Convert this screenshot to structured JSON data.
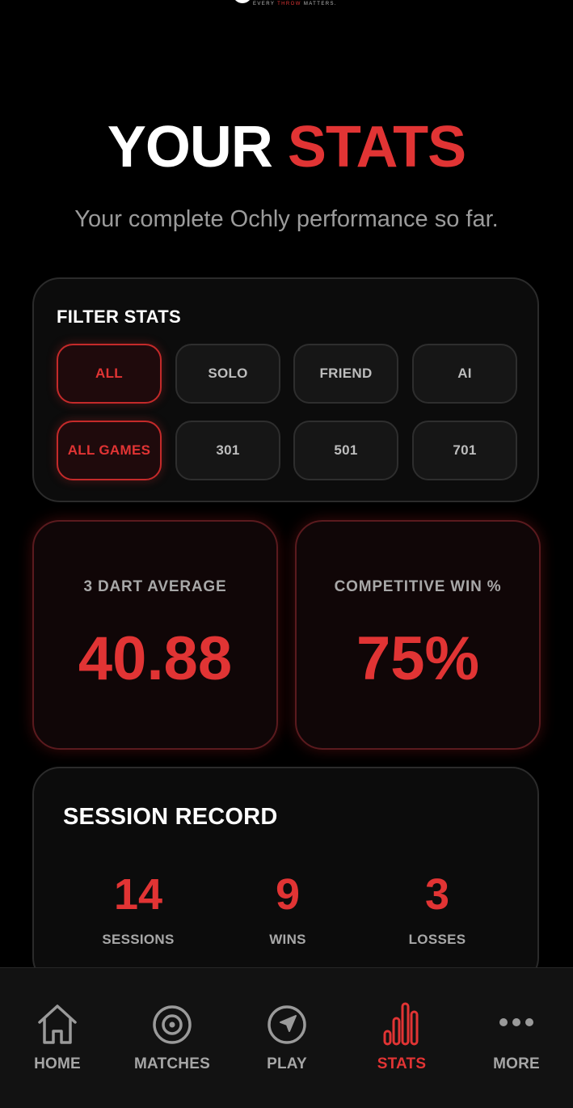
{
  "brand": {
    "tagline_prefix": "EVERY ",
    "tagline_accent": "THROW",
    "tagline_suffix": " MATTERS."
  },
  "header": {
    "title_part1": "YOUR",
    "title_part2": "STATS",
    "subtitle": "Your complete Ochly performance so far."
  },
  "filters": {
    "title": "FILTER STATS",
    "mode_options": [
      "ALL",
      "SOLO",
      "FRIEND",
      "AI"
    ],
    "game_options": [
      "ALL GAMES",
      "301",
      "501",
      "701"
    ],
    "selected_mode": "ALL",
    "selected_game": "ALL GAMES"
  },
  "metrics": {
    "average": {
      "label": "3 DART AVERAGE",
      "value": "40.88"
    },
    "win_pct": {
      "label": "COMPETITIVE WIN %",
      "value": "75%"
    }
  },
  "session_record": {
    "title": "SESSION RECORD",
    "stats": [
      {
        "value": "14",
        "label": "SESSIONS"
      },
      {
        "value": "9",
        "label": "WINS"
      },
      {
        "value": "3",
        "label": "LOSSES"
      }
    ]
  },
  "nav": {
    "active": "STATS",
    "items": [
      {
        "label": "HOME",
        "icon": "home-icon"
      },
      {
        "label": "MATCHES",
        "icon": "target-icon"
      },
      {
        "label": "PLAY",
        "icon": "navigation-arrow-icon"
      },
      {
        "label": "STATS",
        "icon": "bar-chart-icon"
      },
      {
        "label": "MORE",
        "icon": "more-dots-icon"
      }
    ]
  },
  "colors": {
    "accent": "#e13434",
    "background": "#000000",
    "card": "#0c0c0c",
    "muted_text": "#a8a8a8"
  }
}
